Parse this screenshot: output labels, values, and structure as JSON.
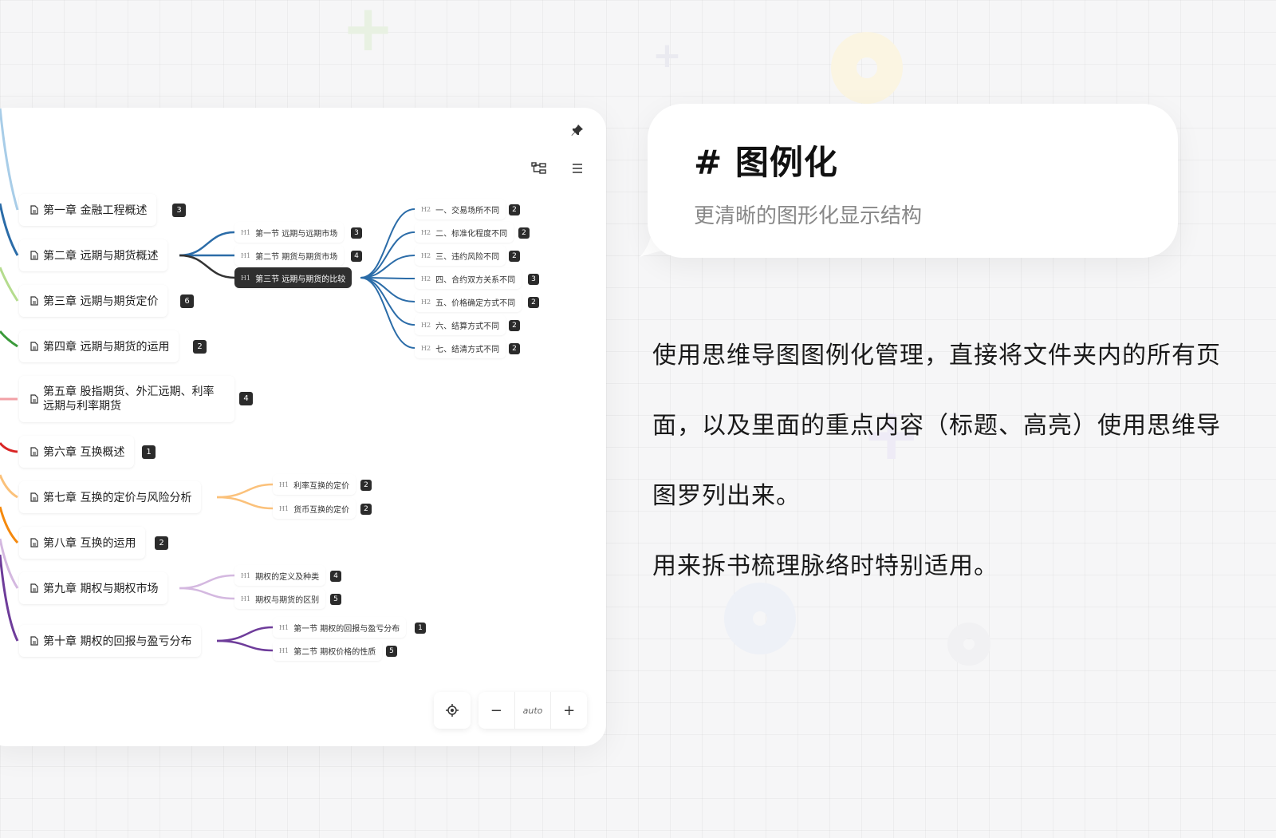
{
  "feature_card": {
    "title": "# 图例化",
    "subtitle": "更清晰的图形化显示结构"
  },
  "description": {
    "paragraph_1": "使用思维导图图例化管理，直接将文件夹内的所有页面，以及里面的重点内容（标题、高亮）使用思维导图罗列出来。",
    "paragraph_2": "用来拆书梳理脉络时特别适用。"
  },
  "toolbar": {
    "pin_icon": "pin-icon",
    "layout_icon": "mindmap-layout-icon",
    "menu_icon": "menu-icon"
  },
  "zoom": {
    "locate_icon": "locate-icon",
    "minus_label": "−",
    "level": "auto",
    "plus_label": "+"
  },
  "mindmap": {
    "chapters": [
      {
        "label": "第一章 金融工程概述",
        "count": "3",
        "color": "#a8cde8"
      },
      {
        "label": "第二章 远期与期货概述",
        "count": "",
        "color": "#2b6ca8"
      },
      {
        "label": "第三章 远期与期货定价",
        "count": "6",
        "color": "#b5dc8e"
      },
      {
        "label": "第四章 远期与期货的运用",
        "count": "2",
        "color": "#3a9a3a"
      },
      {
        "label": "第五章 股指期货、外汇远期、利率远期与利率期货",
        "count": "4",
        "color": "#f2a0a6"
      },
      {
        "label": "第六章 互换概述",
        "count": "1",
        "color": "#d92424"
      },
      {
        "label": "第七章 互换的定价与风险分析",
        "count": "",
        "color": "#fbc17a"
      },
      {
        "label": "第八章 互换的运用",
        "count": "2",
        "color": "#f5890d"
      },
      {
        "label": "第九章 期权与期权市场",
        "count": "",
        "color": "#d4b8e0"
      },
      {
        "label": "第十章 期权的回报与盈亏分布",
        "count": "",
        "color": "#6e3c9a"
      }
    ],
    "chapter2_sections": [
      {
        "tag": "H1",
        "label": "第一节 远期与远期市场",
        "count": "3"
      },
      {
        "tag": "H1",
        "label": "第二节 期货与期货市场",
        "count": "4"
      },
      {
        "tag": "H1",
        "label": "第三节 远期与期货的比较",
        "count": ""
      }
    ],
    "section3_items": [
      {
        "tag": "H2",
        "label": "一、交易场所不同",
        "count": "2"
      },
      {
        "tag": "H2",
        "label": "二、标准化程度不同",
        "count": "2"
      },
      {
        "tag": "H2",
        "label": "三、违约风险不同",
        "count": "2"
      },
      {
        "tag": "H2",
        "label": "四、合约双方关系不同",
        "count": "3"
      },
      {
        "tag": "H2",
        "label": "五、价格确定方式不同",
        "count": "2"
      },
      {
        "tag": "H2",
        "label": "六、结算方式不同",
        "count": "2"
      },
      {
        "tag": "H2",
        "label": "七、结清方式不同",
        "count": "2"
      }
    ],
    "chapter7_sections": [
      {
        "tag": "H1",
        "label": "利率互换的定价",
        "count": "2"
      },
      {
        "tag": "H1",
        "label": "货币互换的定价",
        "count": "2"
      }
    ],
    "chapter9_sections": [
      {
        "tag": "H1",
        "label": "期权的定义及种类",
        "count": "4"
      },
      {
        "tag": "H1",
        "label": "期权与期货的区别",
        "count": "5"
      }
    ],
    "chapter10_sections": [
      {
        "tag": "H1",
        "label": "第一节 期权的回报与盈亏分布",
        "count": "1"
      },
      {
        "tag": "H1",
        "label": "第二节 期权价格的性质",
        "count": "5"
      }
    ]
  }
}
